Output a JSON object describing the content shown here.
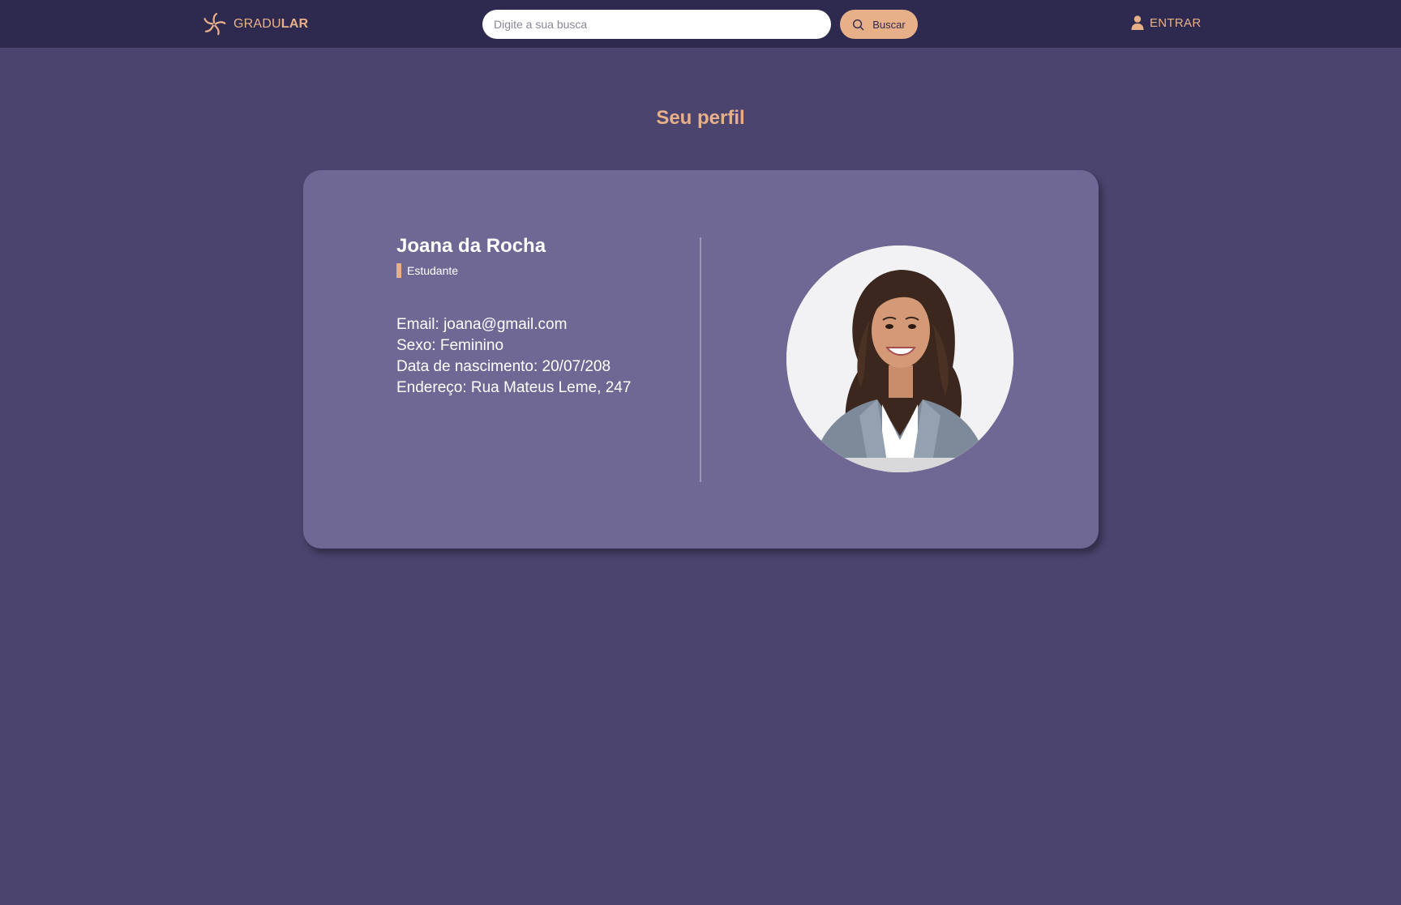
{
  "header": {
    "brand": {
      "light": "GRADU",
      "bold": "LAR",
      "icon": "pinwheel-logo-icon"
    },
    "search": {
      "placeholder": "Digite a sua busca",
      "button_label": "Buscar",
      "icon": "search-icon"
    },
    "login": {
      "label": "ENTRAR",
      "icon": "user-icon"
    }
  },
  "page": {
    "title": "Seu perfil"
  },
  "profile": {
    "name": "Joana da Rocha",
    "role": "Estudante",
    "details": [
      "Email: joana@gmail.com",
      "Sexo: Feminino",
      "Data de nascimento: 20/07/208",
      "Endereço: Rua Mateus Leme, 247"
    ],
    "avatar": "profile-photo"
  },
  "colors": {
    "header_bg": "#2e2a4f",
    "page_bg": "#4a446e",
    "card_bg": "#6f6895",
    "accent": "#e8b089",
    "text": "#ffffff"
  }
}
